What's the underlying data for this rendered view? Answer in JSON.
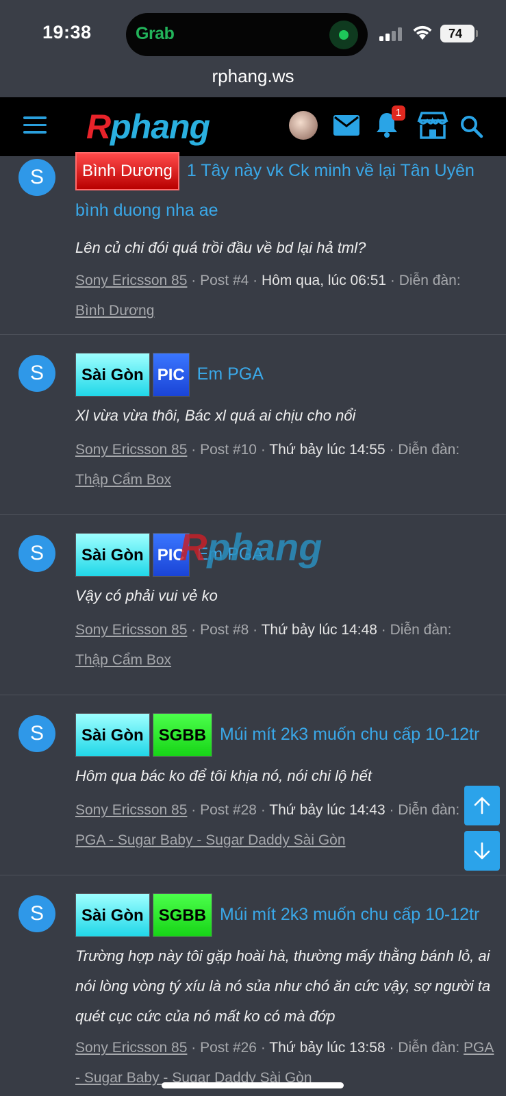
{
  "status_bar": {
    "time": "19:38",
    "live_activity_app": "Grab",
    "battery": "74"
  },
  "browser": {
    "url": "rphang.ws"
  },
  "header": {
    "logo_r": "R",
    "logo_rest": "phang",
    "notification_count": "1",
    "icons": [
      "menu-icon",
      "avatar",
      "mail-icon",
      "bell-icon",
      "store-icon",
      "search-icon"
    ]
  },
  "watermark": {
    "r": "R",
    "rest": "phang"
  },
  "results": [
    {
      "avatar": "S",
      "tags": [
        {
          "label": "Bình Dương",
          "kind": "bd"
        }
      ],
      "title": "1 Tây này vk Ck minh về lại Tân Uyên bình duong nha ae",
      "snippet": "Lên củ chi đói quá trồi đầu về bd lại hả tml?",
      "author": "Sony Ericsson 85",
      "post": "Post #4",
      "date": "Hôm qua, lúc 06:51",
      "forum_label": "Diễn đàn:",
      "forum": "Bình Dương"
    },
    {
      "avatar": "S",
      "tags": [
        {
          "label": "Sài Gòn",
          "kind": "sg"
        },
        {
          "label": "PIC",
          "kind": "pic"
        }
      ],
      "title": "Em PGA",
      "snippet": "Xl vừa vừa thôi, Bác xl quá ai chịu cho nổi",
      "author": "Sony Ericsson 85",
      "post": "Post #10",
      "date": "Thứ bảy lúc 14:55",
      "forum_label": "Diễn đàn:",
      "forum": "Thập Cẩm Box"
    },
    {
      "avatar": "S",
      "tags": [
        {
          "label": "Sài Gòn",
          "kind": "sg"
        },
        {
          "label": "PIC",
          "kind": "pic"
        }
      ],
      "title": "Em PGA",
      "snippet": "Vậy có phải vui vẻ ko",
      "author": "Sony Ericsson 85",
      "post": "Post #8",
      "date": "Thứ bảy lúc 14:48",
      "forum_label": "Diễn đàn:",
      "forum": "Thập Cẩm Box"
    },
    {
      "avatar": "S",
      "tags": [
        {
          "label": "Sài Gòn",
          "kind": "sg"
        },
        {
          "label": "SGBB",
          "kind": "sgbb"
        }
      ],
      "title": "Múi mít 2k3 muốn chu cấp 10-12tr",
      "snippet": "Hôm qua bác ko để tôi khịa nó, nói chi lộ hết",
      "author": "Sony Ericsson 85",
      "post": "Post #28",
      "date": "Thứ bảy lúc 14:43",
      "forum_label": "Diễn đàn:",
      "forum": "PGA - Sugar Baby - Sugar Daddy Sài Gòn"
    },
    {
      "avatar": "S",
      "tags": [
        {
          "label": "Sài Gòn",
          "kind": "sg"
        },
        {
          "label": "SGBB",
          "kind": "sgbb"
        }
      ],
      "title": "Múi mít 2k3 muốn chu cấp 10-12tr",
      "snippet": "Trường hợp này tôi gặp hoài hà, thường mấy thằng bánh lỏ, ai nói lòng vòng tý xíu là nó sủa như chó ăn cức vậy, sợ người ta quét cục cức của nó mất ko có mà đớp",
      "author": "Sony Ericsson 85",
      "post": "Post #26",
      "date": "Thứ bảy lúc 13:58",
      "forum_label": "Diễn đàn:",
      "forum": "PGA - Sugar Baby - Sugar Daddy Sài Gòn"
    }
  ],
  "scroll_buttons": [
    "scroll-up",
    "scroll-down"
  ]
}
